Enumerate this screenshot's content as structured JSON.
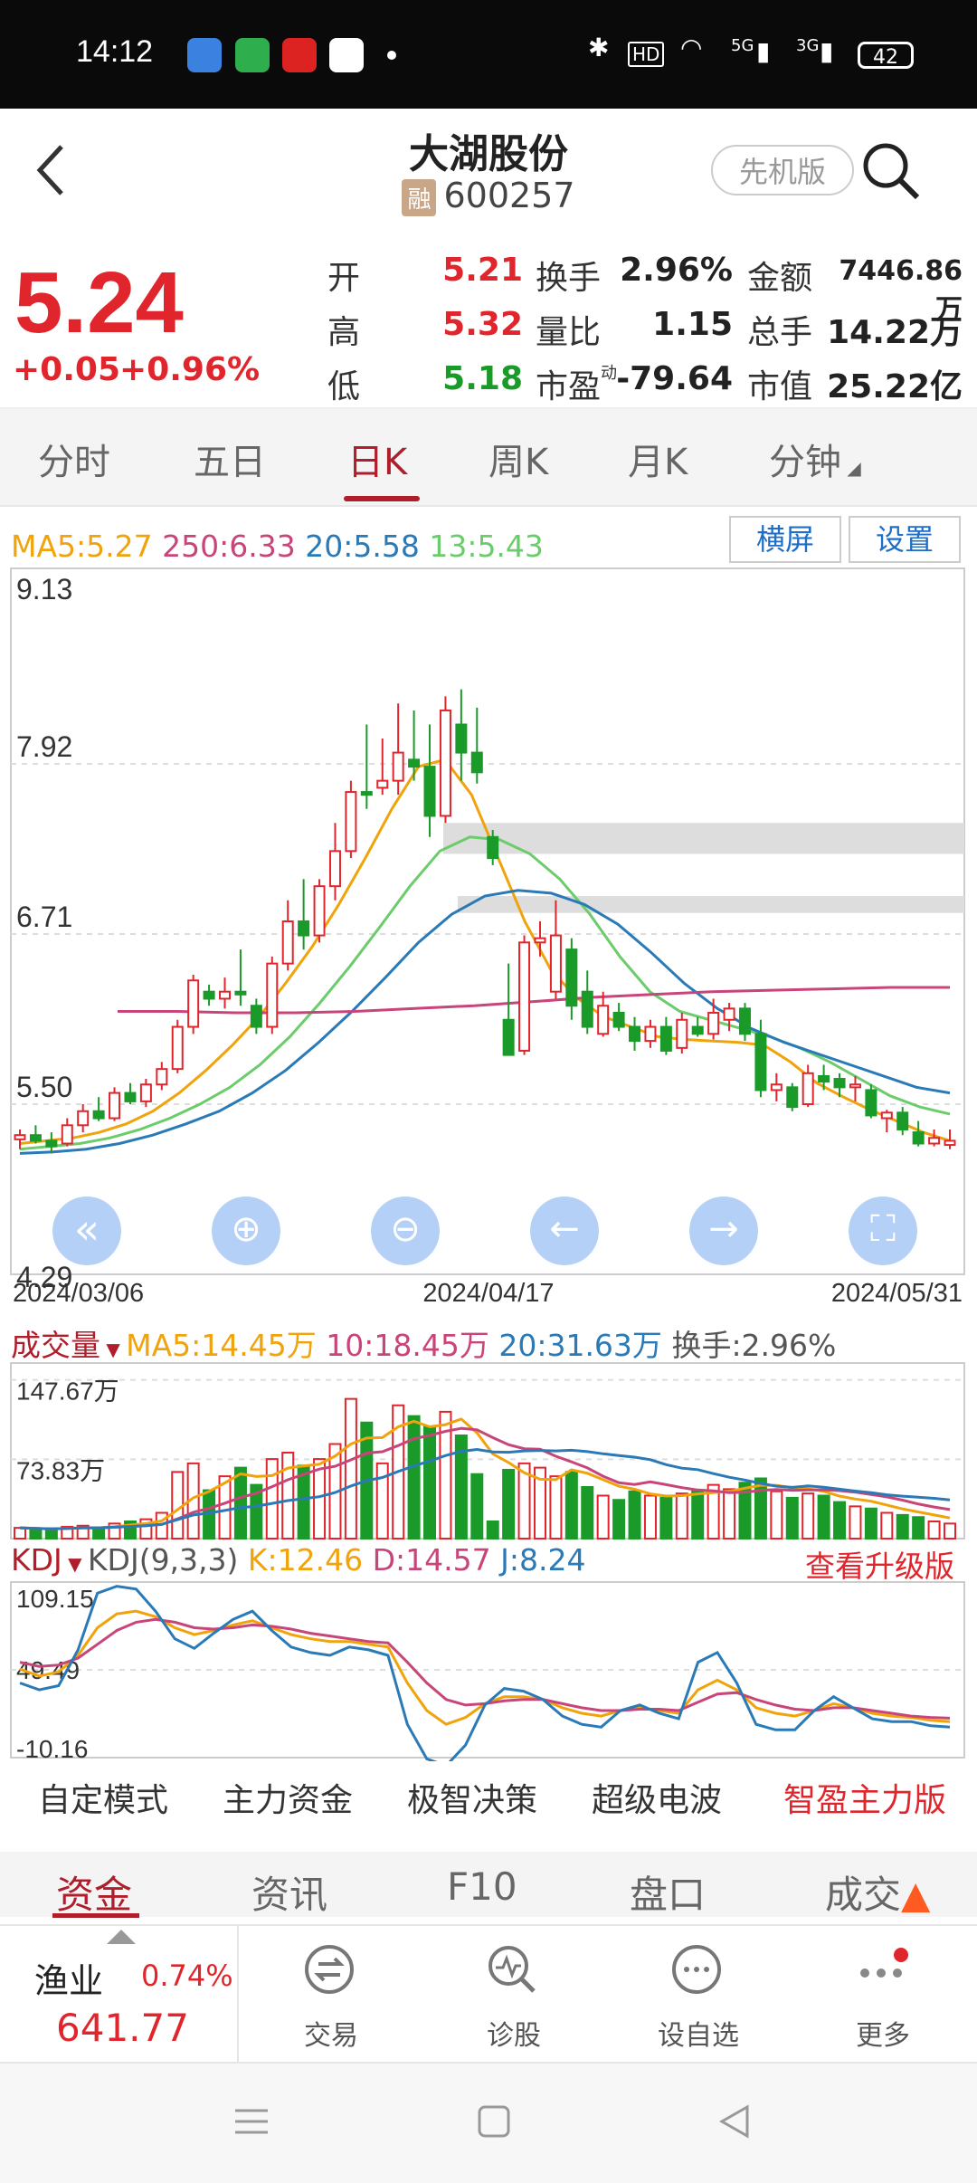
{
  "status_bar": {
    "time": "14:12",
    "battery": "42",
    "network_1": "5G",
    "network_2": "3G"
  },
  "header": {
    "title": "大湖股份",
    "badge": "融",
    "code": "600257",
    "lite_button": "先机版"
  },
  "quote": {
    "price": "5.24",
    "change": "+0.05",
    "change_pct": "+0.96%",
    "stats": [
      {
        "label": "开",
        "value": "5.21",
        "color": "#e0262c"
      },
      {
        "label": "换手",
        "value": "2.96%"
      },
      {
        "label": "金额",
        "value": "7446.86万"
      },
      {
        "label": "高",
        "value": "5.32",
        "color": "#e0262c"
      },
      {
        "label": "量比",
        "value": "1.15"
      },
      {
        "label": "总手",
        "value": "14.22万"
      },
      {
        "label": "低",
        "value": "5.18",
        "color": "#1a9a28"
      },
      {
        "label": "市盈",
        "value": "-79.64",
        "sub": "动"
      },
      {
        "label": "市值",
        "value": "25.22亿"
      }
    ]
  },
  "period_tabs": [
    {
      "label": "分时"
    },
    {
      "label": "五日"
    },
    {
      "label": "日K",
      "active": true
    },
    {
      "label": "周K"
    },
    {
      "label": "月K"
    },
    {
      "label": "分钟"
    }
  ],
  "kline": {
    "ma_legend": [
      {
        "text": "MA5:5.27",
        "color": "#f0a30a"
      },
      {
        "text": "250:6.33",
        "color": "#c8457a"
      },
      {
        "text": "20:5.58",
        "color": "#2a7ab8"
      },
      {
        "text": "13:5.43",
        "color": "#6ccc6c"
      }
    ],
    "landscape_button": "横屏",
    "settings_button": "设置",
    "ytick_labels": [
      "9.13",
      "7.92",
      "6.71",
      "5.50",
      "4.29"
    ],
    "date_labels": [
      "2024/03/06",
      "2024/04/17",
      "2024/05/31"
    ]
  },
  "volume": {
    "title": "成交量",
    "legend": [
      {
        "text": "MA5:14.45万",
        "color": "#f0a30a"
      },
      {
        "text": "10:18.45万",
        "color": "#c8457a"
      },
      {
        "text": "20:31.63万",
        "color": "#2a7ab8"
      },
      {
        "text": "换手:2.96%",
        "color": "#555555"
      }
    ],
    "ytick_labels": [
      "147.67万",
      "73.83万"
    ]
  },
  "kdj": {
    "title": "KDJ",
    "legend": [
      {
        "text": "KDJ(9,3,3)",
        "color": "#555555"
      },
      {
        "text": "K:12.46",
        "color": "#f0a30a"
      },
      {
        "text": "D:14.57",
        "color": "#c8457a"
      },
      {
        "text": "J:8.24",
        "color": "#2a7ab8"
      }
    ],
    "upgrade_link": "查看升级版",
    "ytick_labels": [
      "109.15",
      "49.49",
      "-10.16"
    ]
  },
  "tool_row": [
    "自定模式",
    "主力资金",
    "极智决策",
    "超级电波",
    "智盈主力版"
  ],
  "bottom_tabs": [
    {
      "label": "资金",
      "active": true
    },
    {
      "label": "资讯"
    },
    {
      "label": "F10"
    },
    {
      "label": "盘口"
    },
    {
      "label": "成交"
    }
  ],
  "dock": {
    "sector_name": "渔业",
    "sector_pct": "0.74%",
    "sector_value": "641.77",
    "items": [
      {
        "label": "交易"
      },
      {
        "label": "诊股"
      },
      {
        "label": "设自选"
      },
      {
        "label": "更多"
      }
    ]
  },
  "chart_data": [
    {
      "type": "candlestick",
      "title": "日K",
      "ylim": [
        4.29,
        9.13
      ],
      "x_range": [
        "2024/03/06",
        "2024/05/31"
      ],
      "candles": [
        [
          5.25,
          5.32,
          5.18,
          5.28
        ],
        [
          5.28,
          5.35,
          5.22,
          5.24
        ],
        [
          5.24,
          5.3,
          5.15,
          5.2
        ],
        [
          5.22,
          5.4,
          5.2,
          5.35
        ],
        [
          5.35,
          5.5,
          5.3,
          5.45
        ],
        [
          5.45,
          5.55,
          5.38,
          5.4
        ],
        [
          5.4,
          5.62,
          5.38,
          5.58
        ],
        [
          5.58,
          5.65,
          5.5,
          5.52
        ],
        [
          5.52,
          5.68,
          5.48,
          5.64
        ],
        [
          5.64,
          5.8,
          5.6,
          5.75
        ],
        [
          5.75,
          6.1,
          5.72,
          6.05
        ],
        [
          6.05,
          6.42,
          6.0,
          6.38
        ],
        [
          6.3,
          6.35,
          6.2,
          6.25
        ],
        [
          6.25,
          6.4,
          6.18,
          6.3
        ],
        [
          6.3,
          6.6,
          6.2,
          6.28
        ],
        [
          6.2,
          6.25,
          6.0,
          6.05
        ],
        [
          6.05,
          6.55,
          6.0,
          6.5
        ],
        [
          6.5,
          6.95,
          6.45,
          6.8
        ],
        [
          6.8,
          7.1,
          6.6,
          6.7
        ],
        [
          6.7,
          7.1,
          6.65,
          7.05
        ],
        [
          7.05,
          7.5,
          6.95,
          7.3
        ],
        [
          7.3,
          7.8,
          7.25,
          7.72
        ],
        [
          7.72,
          8.2,
          7.6,
          7.7
        ],
        [
          7.75,
          8.1,
          7.7,
          7.8
        ],
        [
          7.8,
          8.35,
          7.7,
          8.0
        ],
        [
          7.95,
          8.3,
          7.8,
          7.9
        ],
        [
          7.9,
          8.2,
          7.4,
          7.55
        ],
        [
          7.55,
          8.4,
          7.5,
          8.3
        ],
        [
          8.2,
          8.45,
          7.8,
          8.0
        ],
        [
          8.0,
          8.32,
          7.78,
          7.86
        ],
        [
          7.4,
          7.45,
          7.2,
          7.25
        ],
        [
          6.1,
          6.5,
          5.85,
          5.85
        ],
        [
          5.88,
          6.7,
          5.85,
          6.65
        ],
        [
          6.65,
          6.8,
          6.55,
          6.68
        ],
        [
          6.3,
          6.95,
          6.25,
          6.7
        ],
        [
          6.6,
          6.68,
          6.1,
          6.2
        ],
        [
          6.3,
          6.45,
          6.0,
          6.05
        ],
        [
          6.0,
          6.3,
          5.98,
          6.2
        ],
        [
          6.15,
          6.22,
          6.02,
          6.05
        ],
        [
          6.05,
          6.12,
          5.88,
          5.95
        ],
        [
          5.95,
          6.1,
          5.9,
          6.05
        ],
        [
          6.05,
          6.12,
          5.85,
          5.88
        ],
        [
          5.9,
          6.15,
          5.86,
          6.1
        ],
        [
          6.05,
          6.12,
          5.98,
          6.0
        ],
        [
          6.0,
          6.25,
          5.96,
          6.15
        ],
        [
          6.1,
          6.22,
          6.02,
          6.18
        ],
        [
          6.18,
          6.22,
          5.95,
          6.0
        ],
        [
          6.0,
          6.1,
          5.55,
          5.6
        ],
        [
          5.6,
          5.72,
          5.52,
          5.64
        ],
        [
          5.62,
          5.65,
          5.45,
          5.48
        ],
        [
          5.5,
          5.78,
          5.48,
          5.72
        ],
        [
          5.7,
          5.78,
          5.6,
          5.66
        ],
        [
          5.68,
          5.72,
          5.55,
          5.62
        ],
        [
          5.62,
          5.7,
          5.52,
          5.64
        ],
        [
          5.6,
          5.64,
          5.4,
          5.42
        ],
        [
          5.4,
          5.46,
          5.3,
          5.44
        ],
        [
          5.44,
          5.48,
          5.28,
          5.32
        ],
        [
          5.3,
          5.38,
          5.2,
          5.22
        ],
        [
          5.22,
          5.32,
          5.2,
          5.26
        ],
        [
          5.21,
          5.32,
          5.18,
          5.24
        ]
      ],
      "ma": {
        "MA5": [
          5.22,
          5.24,
          5.26,
          5.3,
          5.36,
          5.45,
          5.58,
          5.74,
          5.92,
          6.12,
          6.36,
          6.62,
          6.92,
          7.25,
          7.6,
          7.9,
          7.95,
          7.7,
          7.25,
          6.8,
          6.45,
          6.25,
          6.12,
          6.05,
          5.98,
          5.96,
          5.95,
          5.94,
          5.92,
          5.8,
          5.65,
          5.55,
          5.46,
          5.38,
          5.3,
          5.24
        ],
        "MA13": [
          5.18,
          5.2,
          5.22,
          5.26,
          5.32,
          5.4,
          5.5,
          5.62,
          5.78,
          5.98,
          6.22,
          6.48,
          6.76,
          7.05,
          7.3,
          7.4,
          7.38,
          7.28,
          7.1,
          6.85,
          6.55,
          6.3,
          6.16,
          6.1,
          6.04,
          5.98,
          5.9,
          5.8,
          5.68,
          5.56,
          5.48,
          5.43
        ],
        "MA20": [
          5.15,
          5.16,
          5.18,
          5.22,
          5.28,
          5.36,
          5.45,
          5.58,
          5.74,
          5.94,
          6.16,
          6.4,
          6.65,
          6.85,
          6.98,
          7.02,
          7.0,
          6.92,
          6.78,
          6.58,
          6.36,
          6.18,
          6.04,
          5.94,
          5.86,
          5.78,
          5.7,
          5.62,
          5.58
        ],
        "MA250": [
          6.16,
          6.16,
          6.15,
          6.15,
          6.16,
          6.18,
          6.2,
          6.23,
          6.26,
          6.28,
          6.3,
          6.31,
          6.32,
          6.33,
          6.33
        ]
      }
    },
    {
      "type": "bar",
      "title": "成交量",
      "ylim": [
        0,
        160
      ],
      "unit": "万",
      "values": [
        10,
        9,
        8,
        11,
        12,
        10,
        14,
        16,
        18,
        24,
        62,
        70,
        45,
        58,
        66,
        50,
        74,
        80,
        68,
        74,
        88,
        130,
        108,
        70,
        124,
        114,
        104,
        118,
        96,
        60,
        16,
        64,
        70,
        66,
        58,
        62,
        48,
        40,
        36,
        44,
        40,
        38,
        42,
        44,
        50,
        46,
        52,
        56,
        44,
        38,
        42,
        40,
        34,
        30,
        28,
        24,
        22,
        20,
        16,
        14
      ]
    },
    {
      "type": "line",
      "title": "KDJ",
      "ylim": [
        -10.16,
        109.15
      ],
      "series": [
        {
          "name": "K",
          "values": [
            50,
            45,
            48,
            60,
            80,
            90,
            92,
            88,
            80,
            75,
            78,
            82,
            85,
            80,
            75,
            72,
            70,
            70,
            68,
            66,
            40,
            20,
            10,
            15,
            25,
            30,
            30,
            28,
            22,
            18,
            16,
            20,
            22,
            20,
            18,
            35,
            42,
            35,
            22,
            18,
            16,
            20,
            25,
            22,
            18,
            16,
            15,
            13,
            12
          ]
        },
        {
          "name": "D",
          "values": [
            55,
            52,
            53,
            58,
            68,
            78,
            84,
            86,
            84,
            80,
            79,
            80,
            82,
            81,
            79,
            76,
            74,
            72,
            70,
            69,
            55,
            40,
            28,
            24,
            25,
            27,
            28,
            28,
            25,
            22,
            20,
            20,
            21,
            21,
            20,
            26,
            32,
            33,
            28,
            24,
            21,
            20,
            22,
            22,
            20,
            18,
            16,
            15,
            14.5
          ]
        },
        {
          "name": "J",
          "values": [
            40,
            35,
            38,
            64,
            105,
            110,
            108,
            92,
            72,
            65,
            76,
            86,
            92,
            78,
            66,
            62,
            60,
            66,
            64,
            60,
            10,
            -15,
            -20,
            -5,
            24,
            36,
            34,
            28,
            16,
            10,
            8,
            20,
            24,
            18,
            14,
            55,
            62,
            40,
            10,
            6,
            6,
            20,
            30,
            22,
            14,
            12,
            12,
            9,
            8
          ]
        }
      ]
    }
  ]
}
